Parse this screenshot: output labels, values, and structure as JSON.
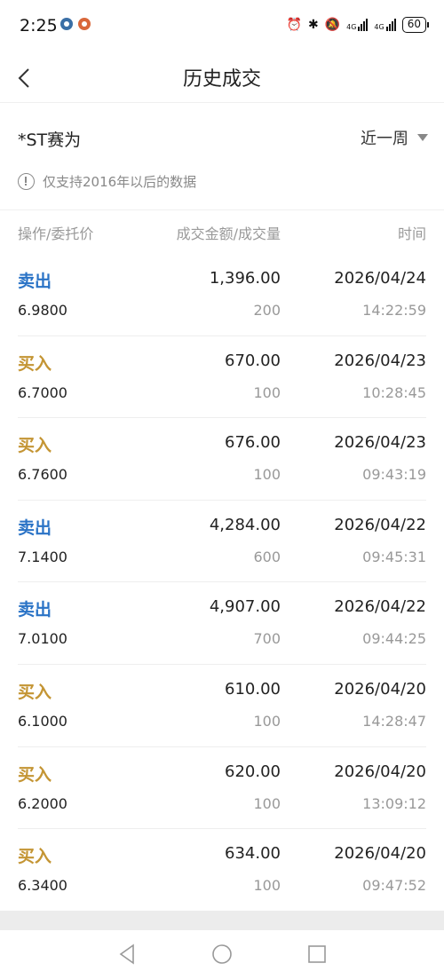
{
  "status_bar": {
    "time": "2:25",
    "network_1": "4G",
    "network_2": "4G",
    "battery": "60"
  },
  "nav": {
    "title": "历史成交"
  },
  "stock": {
    "name": "*ST赛为",
    "period": "近一周"
  },
  "notice": {
    "text": "仅支持2016年以后的数据"
  },
  "columns": {
    "action_price": "操作/委托价",
    "amount_volume": "成交金额/成交量",
    "time": "时间"
  },
  "colors": {
    "sell": "#2a73c6",
    "buy": "#c49534"
  },
  "trades": [
    {
      "action": "卖出",
      "type": "sell",
      "price": "6.9800",
      "amount": "1,396.00",
      "qty": "200",
      "date": "2026/04/24",
      "time": "14:22:59"
    },
    {
      "action": "买入",
      "type": "buy",
      "price": "6.7000",
      "amount": "670.00",
      "qty": "100",
      "date": "2026/04/23",
      "time": "10:28:45"
    },
    {
      "action": "买入",
      "type": "buy",
      "price": "6.7600",
      "amount": "676.00",
      "qty": "100",
      "date": "2026/04/23",
      "time": "09:43:19"
    },
    {
      "action": "卖出",
      "type": "sell",
      "price": "7.1400",
      "amount": "4,284.00",
      "qty": "600",
      "date": "2026/04/22",
      "time": "09:45:31"
    },
    {
      "action": "卖出",
      "type": "sell",
      "price": "7.0100",
      "amount": "4,907.00",
      "qty": "700",
      "date": "2026/04/22",
      "time": "09:44:25"
    },
    {
      "action": "买入",
      "type": "buy",
      "price": "6.1000",
      "amount": "610.00",
      "qty": "100",
      "date": "2026/04/20",
      "time": "14:28:47"
    },
    {
      "action": "买入",
      "type": "buy",
      "price": "6.2000",
      "amount": "620.00",
      "qty": "100",
      "date": "2026/04/20",
      "time": "13:09:12"
    },
    {
      "action": "买入",
      "type": "buy",
      "price": "6.3400",
      "amount": "634.00",
      "qty": "100",
      "date": "2026/04/20",
      "time": "09:47:52"
    }
  ]
}
